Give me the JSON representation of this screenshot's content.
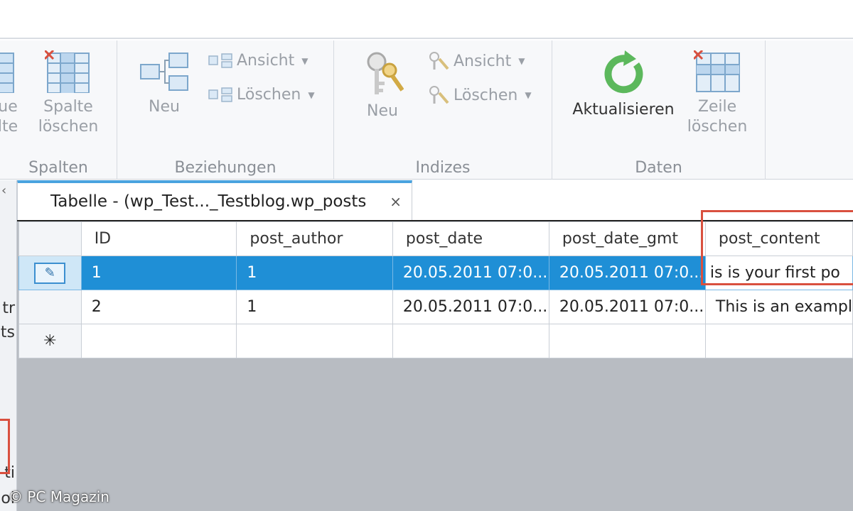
{
  "ribbon": {
    "groups": [
      {
        "label": "Spalten",
        "buttons": [
          {
            "line1": "ue",
            "line2": "lte"
          },
          {
            "line1": "Spalte",
            "line2": "löschen"
          }
        ]
      },
      {
        "label": "Beziehungen",
        "new_label": "Neu",
        "view_label": "Ansicht",
        "delete_label": "Löschen"
      },
      {
        "label": "Indizes",
        "new_label": "Neu",
        "view_label": "Ansicht",
        "delete_label": "Löschen"
      },
      {
        "label": "Daten",
        "refresh_label": "Aktualisieren",
        "delete_row_line1": "Zeile",
        "delete_row_line2": "löschen"
      }
    ]
  },
  "left_panel": {
    "texts": [
      "tr",
      "ts",
      "ti",
      "oi"
    ]
  },
  "tab": {
    "title": "Tabelle - (wp_Test..._Testblog.wp_posts",
    "close": "×"
  },
  "grid": {
    "columns": [
      "ID",
      "post_author",
      "post_date",
      "post_date_gmt",
      "post_content"
    ],
    "rows": [
      [
        "1",
        "1",
        "20.05.2011 07:0...",
        "20.05.2011 07:0...",
        "is is your first po"
      ],
      [
        "2",
        "1",
        "20.05.2011 07:0...",
        "20.05.2011 07:0...",
        "This is an exampl"
      ]
    ],
    "new_row_marker": "✳",
    "edit_marker": "✎"
  },
  "watermark": "© PC Magazin",
  "colors": {
    "accent": "#1f8fd6",
    "highlight_box": "#d9503f",
    "refresh_icon": "#5cb85c"
  }
}
